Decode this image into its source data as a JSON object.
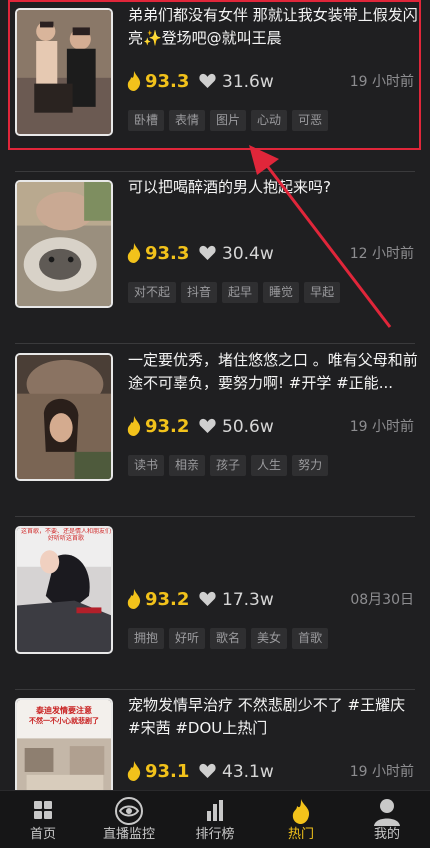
{
  "feed": {
    "items": [
      {
        "title": "弟弟们都没有女伴 那就让我女装带上假发闪亮✨登场吧@就叫王晨",
        "heat": "93.3",
        "likes": "31.6w",
        "time": "19 小时前",
        "tags": [
          "卧槽",
          "表情",
          "图片",
          "心动",
          "可恶"
        ]
      },
      {
        "title": "可以把喝醉酒的男人抱起来吗?",
        "heat": "93.3",
        "likes": "30.4w",
        "time": "12 小时前",
        "tags": [
          "对不起",
          "抖音",
          "起早",
          "睡觉",
          "早起"
        ]
      },
      {
        "title": "一定要优秀，堵住悠悠之口 。唯有父母和前途不可辜负，要努力啊! #开学 #正能...",
        "heat": "93.2",
        "likes": "50.6w",
        "time": "19 小时前",
        "tags": [
          "读书",
          "相亲",
          "孩子",
          "人生",
          "努力"
        ]
      },
      {
        "title": "",
        "heat": "93.2",
        "likes": "17.3w",
        "time": "08月30日",
        "tags": [
          "拥抱",
          "好听",
          "歌名",
          "美女",
          "首歌"
        ],
        "thumb_caption": "这首歌，不要、还是情人和朋友们好听听这首歌"
      },
      {
        "title": "宠物发情早治疗 不然悲剧少不了 #王耀庆 #宋茜 #DOU上热门",
        "heat": "93.1",
        "likes": "43.1w",
        "time": "19 小时前",
        "tags": [],
        "thumb_caption_1": "泰迪发情要注意",
        "thumb_caption_2": "不然一不小心就悲剧了"
      }
    ]
  },
  "nav": {
    "items": [
      {
        "label": "首页",
        "icon": "grid-icon"
      },
      {
        "label": "直播监控",
        "icon": "eye-icon"
      },
      {
        "label": "排行榜",
        "icon": "bar-chart-icon"
      },
      {
        "label": "热门",
        "icon": "flame-icon"
      },
      {
        "label": "我的",
        "icon": "user-icon"
      }
    ],
    "active_index": 3
  },
  "colors": {
    "accent": "#f2c21b",
    "highlight": "#e0263a",
    "background": "#1f1f21"
  }
}
